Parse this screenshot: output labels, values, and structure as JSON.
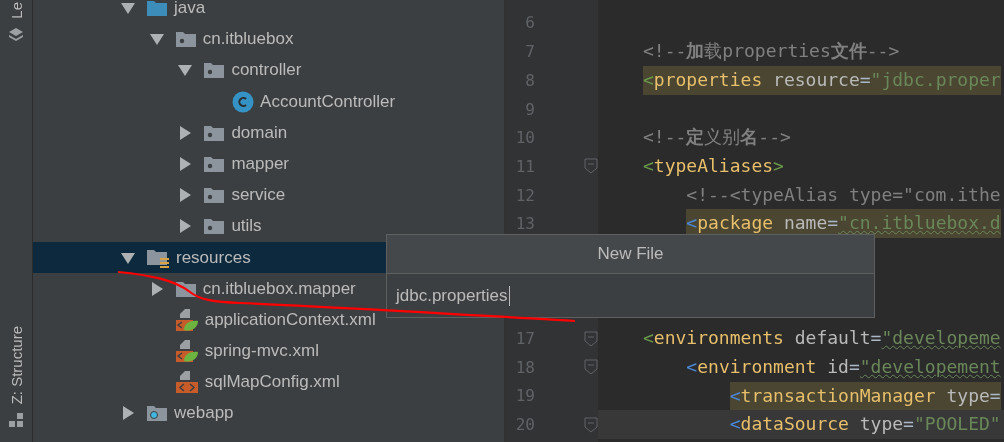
{
  "tool_strip": {
    "top_label": "Le",
    "bottom_label": "Z: Structure"
  },
  "project_tree": [
    {
      "label": "java",
      "kind": "srcfolder",
      "expanded": true,
      "selected": false,
      "children": [
        {
          "label": "cn.itbluebox",
          "kind": "package",
          "expanded": true,
          "selected": false,
          "children": [
            {
              "label": "controller",
              "kind": "package",
              "expanded": true,
              "selected": false,
              "children": [
                {
                  "label": "AccountController",
                  "kind": "class",
                  "selected": false
                }
              ]
            },
            {
              "label": "domain",
              "kind": "package",
              "expanded": false,
              "selected": false
            },
            {
              "label": "mapper",
              "kind": "package",
              "expanded": false,
              "selected": false
            },
            {
              "label": "service",
              "kind": "package",
              "expanded": false,
              "selected": false
            },
            {
              "label": "utils",
              "kind": "package",
              "expanded": false,
              "selected": false
            }
          ]
        }
      ]
    },
    {
      "label": "resources",
      "kind": "resfolder",
      "expanded": true,
      "selected": true,
      "children": [
        {
          "label": "cn.itbluebox.mapper",
          "kind": "folder",
          "expanded": false,
          "selected": false
        },
        {
          "label": "applicationContext.xml",
          "kind": "springxml",
          "selected": false
        },
        {
          "label": "spring-mvc.xml",
          "kind": "springxml",
          "selected": false
        },
        {
          "label": "sqlMapConfig.xml",
          "kind": "xml",
          "selected": false
        }
      ]
    },
    {
      "label": "webapp",
      "kind": "webfolder",
      "expanded": false,
      "selected": false
    }
  ],
  "editor": {
    "lines": [
      {
        "number": "6",
        "fold": false,
        "highlighted": false,
        "current": false
      },
      {
        "number": "7",
        "fold": false,
        "highlighted": false,
        "current": false,
        "tokens": [
          {
            "kind": "comment",
            "text": "<!--"
          },
          {
            "kind": "commentbold",
            "text": "加"
          },
          {
            "kind": "comment",
            "text": "载properties"
          },
          {
            "kind": "commentbold",
            "text": "文件"
          },
          {
            "kind": "comment",
            "text": "-->"
          }
        ]
      },
      {
        "number": "8",
        "fold": false,
        "highlighted": true,
        "current": false,
        "tokens": [
          {
            "kind": "open",
            "text": "<"
          },
          {
            "kind": "tag",
            "text": "properties"
          },
          {
            "kind": "attr",
            "text": " resource"
          },
          {
            "kind": "punct",
            "text": "="
          },
          {
            "kind": "value",
            "text": "\"jdbc.proper"
          }
        ]
      },
      {
        "number": "9",
        "fold": false,
        "highlighted": false,
        "current": false
      },
      {
        "number": "10",
        "fold": false,
        "highlighted": false,
        "current": false,
        "tokens": [
          {
            "kind": "comment",
            "text": "<!--"
          },
          {
            "kind": "commentbold",
            "text": "定"
          },
          {
            "kind": "comment",
            "text": "义别"
          },
          {
            "kind": "commentbold",
            "text": "名"
          },
          {
            "kind": "comment",
            "text": "-->"
          }
        ]
      },
      {
        "number": "11",
        "fold": true,
        "highlighted": false,
        "current": false,
        "tokens": [
          {
            "kind": "open",
            "text": "<"
          },
          {
            "kind": "tag",
            "text": "typeAliases"
          },
          {
            "kind": "open",
            "text": ">"
          }
        ]
      },
      {
        "number": "12",
        "fold": false,
        "highlighted": false,
        "current": false,
        "tokens": [
          {
            "kind": "comment",
            "text": "    <!--<typeAlias type=\"com.ithe"
          }
        ]
      },
      {
        "number": "13",
        "fold": false,
        "highlighted": true,
        "current": false,
        "tokens": [
          {
            "kind": "open2",
            "text": "    <"
          },
          {
            "kind": "tag",
            "text": "package"
          },
          {
            "kind": "attr",
            "text": " name"
          },
          {
            "kind": "punct",
            "text": "="
          },
          {
            "kind": "typo",
            "text": "\"cn.itbluebox.d"
          }
        ]
      },
      {
        "number": "17",
        "fold": true,
        "highlighted": false,
        "current": false,
        "tokens": [
          {
            "kind": "open",
            "text": "<"
          },
          {
            "kind": "tag",
            "text": "environments"
          },
          {
            "kind": "attr",
            "text": " default"
          },
          {
            "kind": "punct",
            "text": "="
          },
          {
            "kind": "typo",
            "text": "\"developeme"
          }
        ]
      },
      {
        "number": "18",
        "fold": true,
        "highlighted": false,
        "current": false,
        "tokens": [
          {
            "kind": "open2",
            "text": "    <"
          },
          {
            "kind": "tag",
            "text": "environment"
          },
          {
            "kind": "attr",
            "text": " id"
          },
          {
            "kind": "punct",
            "text": "="
          },
          {
            "kind": "typo",
            "text": "\"developement"
          }
        ]
      },
      {
        "number": "19",
        "fold": false,
        "highlighted": true,
        "current": false,
        "tokens": [
          {
            "kind": "open2",
            "text": "        <"
          },
          {
            "kind": "tag",
            "text": "transactionManager"
          },
          {
            "kind": "attr",
            "text": " type"
          },
          {
            "kind": "punct",
            "text": "="
          }
        ]
      },
      {
        "number": "20",
        "fold": true,
        "highlighted": false,
        "current": true,
        "tokens": [
          {
            "kind": "open2",
            "text": "        <"
          },
          {
            "kind": "tag",
            "text": "dataSource"
          },
          {
            "kind": "attr",
            "text": " type"
          },
          {
            "kind": "punct",
            "text": "="
          },
          {
            "kind": "value",
            "text": "\"POOLED\""
          }
        ]
      }
    ]
  },
  "new_file_popup": {
    "title": "New File",
    "value": "jdbc.properties"
  }
}
